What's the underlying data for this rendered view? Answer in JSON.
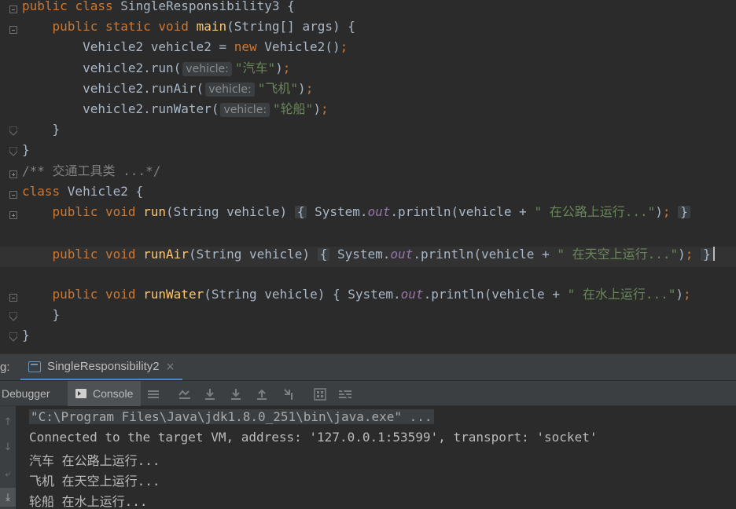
{
  "editor": {
    "lines": [
      {
        "tokens": [
          [
            "kw",
            "public "
          ],
          [
            "kw",
            "class "
          ],
          [
            "cl",
            "SingleResponsibility3 {"
          ]
        ]
      },
      {
        "tokens": [
          [
            "cl",
            "    "
          ],
          [
            "kw",
            "public "
          ],
          [
            "kw",
            "static "
          ],
          [
            "kw",
            "void "
          ],
          [
            "fn",
            "main"
          ],
          [
            "cl",
            "(String[] args) {"
          ]
        ]
      },
      {
        "tokens": [
          [
            "cl",
            "        Vehicle2 vehicle2 = "
          ],
          [
            "kw",
            "new "
          ],
          [
            "cl",
            "Vehicle2()"
          ],
          [
            "punc",
            ";"
          ]
        ]
      },
      {
        "tokens": [
          [
            "cl",
            "        vehicle2.run("
          ],
          [
            "hint",
            "vehicle:"
          ],
          [
            "str",
            "\"汽车\""
          ],
          [
            "cl",
            ")"
          ],
          [
            "punc",
            ";"
          ]
        ]
      },
      {
        "tokens": [
          [
            "cl",
            "        vehicle2.runAir("
          ],
          [
            "hint",
            "vehicle:"
          ],
          [
            "str",
            "\"飞机\""
          ],
          [
            "cl",
            ")"
          ],
          [
            "punc",
            ";"
          ]
        ]
      },
      {
        "tokens": [
          [
            "cl",
            "        vehicle2.runWater("
          ],
          [
            "hint",
            "vehicle:"
          ],
          [
            "str",
            "\"轮船\""
          ],
          [
            "cl",
            ")"
          ],
          [
            "punc",
            ";"
          ]
        ]
      },
      {
        "tokens": [
          [
            "cl",
            "    }"
          ]
        ]
      },
      {
        "tokens": [
          [
            "cl",
            "}"
          ]
        ]
      },
      {
        "tokens": [
          [
            "cmt",
            "/** 交通工具类 ...*/"
          ]
        ]
      },
      {
        "tokens": [
          [
            "kw",
            "class "
          ],
          [
            "cl",
            "Vehicle2 {"
          ]
        ]
      },
      {
        "tokens": [
          [
            "cl",
            "    "
          ],
          [
            "kw",
            "public "
          ],
          [
            "kw",
            "void "
          ],
          [
            "fn",
            "run"
          ],
          [
            "cl",
            "(String vehicle) "
          ],
          [
            "box",
            "{"
          ],
          [
            "cl",
            " System."
          ],
          [
            "fld",
            "out"
          ],
          [
            "cl",
            ".println(vehicle + "
          ],
          [
            "str",
            "\" 在公路上运行...\""
          ],
          [
            "cl",
            ")"
          ],
          [
            "punc",
            "; "
          ],
          [
            "box",
            "}"
          ]
        ]
      },
      {
        "tokens": []
      },
      {
        "tokens": [
          [
            "cl",
            "    "
          ],
          [
            "kw",
            "public "
          ],
          [
            "kw",
            "void "
          ],
          [
            "fn",
            "runAir"
          ],
          [
            "cl",
            "(String vehicle) "
          ],
          [
            "box",
            "{"
          ],
          [
            "cl",
            " System."
          ],
          [
            "fld",
            "out"
          ],
          [
            "cl",
            ".println(vehicle + "
          ],
          [
            "str",
            "\" 在天空上运行...\""
          ],
          [
            "cl",
            ")"
          ],
          [
            "punc",
            "; "
          ],
          [
            "box",
            "}"
          ],
          [
            "caret",
            ""
          ]
        ]
      },
      {
        "tokens": []
      },
      {
        "tokens": [
          [
            "cl",
            "    "
          ],
          [
            "kw",
            "public "
          ],
          [
            "kw",
            "void "
          ],
          [
            "fn",
            "runWater"
          ],
          [
            "cl",
            "(String vehicle) { System."
          ],
          [
            "fld",
            "out"
          ],
          [
            "cl",
            ".println(vehicle + "
          ],
          [
            "str",
            "\" 在水上运行...\""
          ],
          [
            "cl",
            ")"
          ],
          [
            "punc",
            ";"
          ]
        ]
      },
      {
        "tokens": [
          [
            "cl",
            "    }"
          ]
        ]
      },
      {
        "tokens": [
          [
            "cl",
            "}"
          ]
        ]
      }
    ]
  },
  "tool_window": {
    "label": "g:",
    "run_tab_label": "SingleResponsibility2",
    "run_tab_close": "×",
    "subtabs": {
      "debugger": "Debugger",
      "console": "Console"
    }
  },
  "console": {
    "lines": [
      "\"C:\\Program Files\\Java\\jdk1.8.0_251\\bin\\java.exe\" ...",
      "Connected to the target VM, address: '127.0.0.1:53599', transport: 'socket'",
      "汽车 在公路上运行...",
      "飞机 在天空上运行...",
      "轮船 在水上运行..."
    ]
  },
  "icons": {
    "toolbar": [
      "menu-icon",
      "show-execution-point-icon",
      "step-over-icon",
      "step-into-icon",
      "force-step-into-icon",
      "step-out-icon",
      "run-to-cursor-icon",
      "evaluate-expression-icon",
      "trace-icon"
    ],
    "side": [
      "up-arrow-icon",
      "down-arrow-icon",
      "soft-wrap-icon",
      "scroll-to-end-icon"
    ]
  }
}
